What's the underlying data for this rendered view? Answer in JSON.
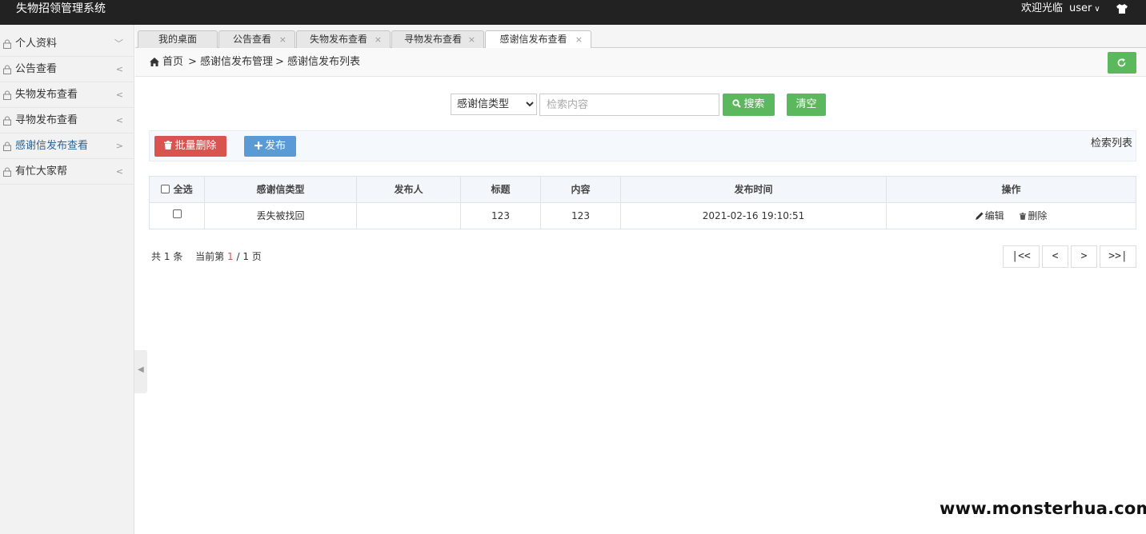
{
  "header": {
    "title": "失物招领管理系统",
    "welcome": "欢迎光临",
    "username": "user"
  },
  "sidebar": {
    "items": [
      {
        "label": "个人资料",
        "arrow": "﹀"
      },
      {
        "label": "公告查看",
        "arrow": "<"
      },
      {
        "label": "失物发布查看",
        "arrow": "<"
      },
      {
        "label": "寻物发布查看",
        "arrow": "<"
      },
      {
        "label": "感谢信发布查看",
        "arrow": ">"
      },
      {
        "label": "有忙大家帮",
        "arrow": "<"
      }
    ],
    "active_index": 4
  },
  "tabs": [
    {
      "label": "我的桌面",
      "close": ""
    },
    {
      "label": "公告查看",
      "close": "×"
    },
    {
      "label": "失物发布查看",
      "close": "×"
    },
    {
      "label": "寻物发布查看",
      "close": "×"
    },
    {
      "label": "感谢信发布查看",
      "close": "×"
    }
  ],
  "breadcrumb": {
    "home": "首页",
    "level1": "> 感谢信发布管理",
    "level2": "> 感谢信发布列表"
  },
  "search": {
    "type_selected": "感谢信类型",
    "placeholder": "检索内容",
    "value": "",
    "search_label": "搜索",
    "clear_label": "清空"
  },
  "toolbar": {
    "batch_delete_label": "批量删除",
    "publish_label": "发布",
    "list_label": "检索列表"
  },
  "table": {
    "select_all_label": "全选",
    "columns": [
      "感谢信类型",
      "发布人",
      "标题",
      "内容",
      "发布时间",
      "操作"
    ],
    "rows": [
      {
        "type": "丢失被找回",
        "publisher": "",
        "title": "123",
        "content": "123",
        "time": "2021-02-16 19:10:51",
        "edit_label": "编辑",
        "delete_label": "删除"
      }
    ]
  },
  "pagination": {
    "total_prefix": "共",
    "total": "1",
    "total_suffix": "条",
    "current_prefix": "当前第",
    "current": "1",
    "pages": "/ 1",
    "pages_suffix": "页",
    "first": "|<<",
    "prev": "<",
    "next": ">",
    "last": ">>|"
  },
  "watermark": "www.monsterhua.com",
  "colors": {
    "topbar": "#222222",
    "green": "#5cb85c",
    "red": "#d9534f",
    "blue": "#5b9bd5"
  }
}
